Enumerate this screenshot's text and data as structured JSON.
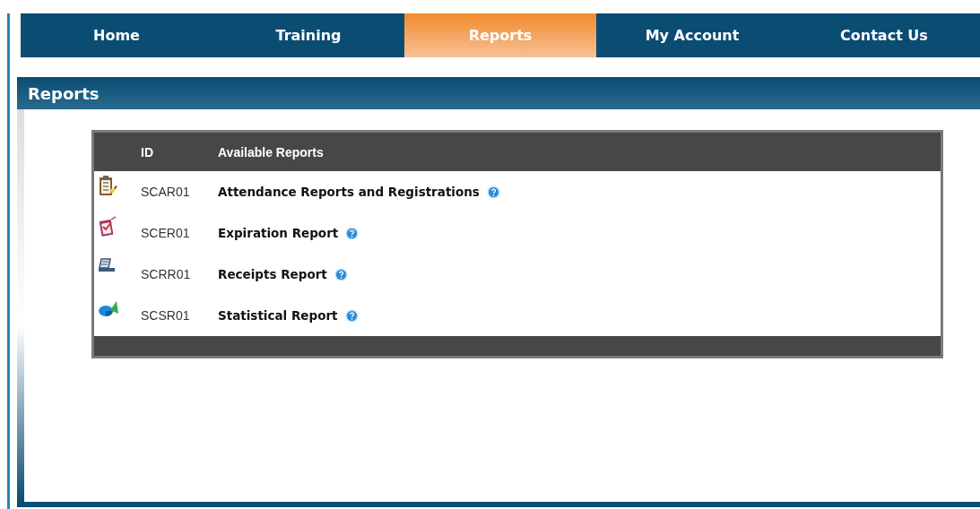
{
  "nav": {
    "tabs": [
      {
        "label": "Home",
        "selected": false
      },
      {
        "label": "Training",
        "selected": false
      },
      {
        "label": "Reports",
        "selected": true
      },
      {
        "label": "My Account",
        "selected": false
      },
      {
        "label": "Contact Us",
        "selected": false
      }
    ]
  },
  "panel": {
    "title": "Reports",
    "table": {
      "columns": [
        "ID",
        "Available Reports"
      ],
      "rows": [
        {
          "id": "SCAR01",
          "name": "Attendance Reports and Registrations"
        },
        {
          "id": "SCER01",
          "name": "Expiration Report"
        },
        {
          "id": "SCRR01",
          "name": "Receipts Report"
        },
        {
          "id": "SCSR01",
          "name": "Statistical Report"
        }
      ]
    }
  }
}
